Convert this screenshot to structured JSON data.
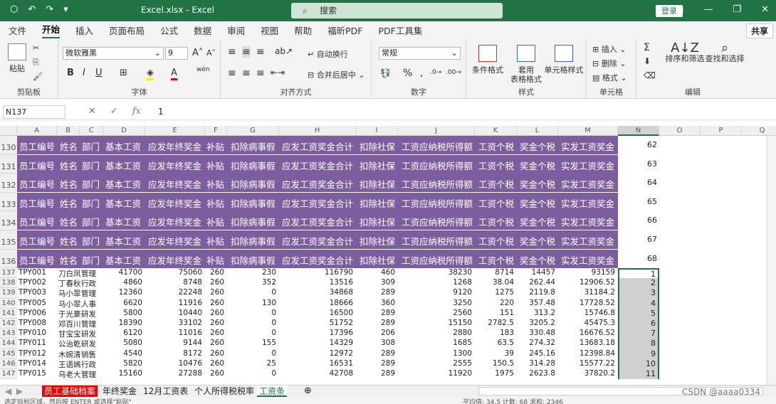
{
  "titlebar": {
    "title": "Excel.xlsx  -  Excel",
    "search": "搜索",
    "login": "登录"
  },
  "tabs": [
    "文件",
    "开始",
    "插入",
    "页面布局",
    "公式",
    "数据",
    "审阅",
    "视图",
    "帮助",
    "福昕PDF",
    "PDF工具集"
  ],
  "share": "共享",
  "ribbon": {
    "paste": "粘贴",
    "clipboard": "剪贴板",
    "font_name": "微软雅黑",
    "font_size": "9",
    "font_group": "字体",
    "wrap": "自动换行",
    "merge": "合并后居中",
    "align_group": "对齐方式",
    "number_format": "常规",
    "number_group": "数字",
    "cond": "条件格式",
    "table_fmt": "套用\n表格格式",
    "cell_style": "单元格样式",
    "style_group": "样式",
    "insert": "插入",
    "delete": "删除",
    "format": "格式",
    "cells_group": "单元格",
    "sort": "排序和筛选",
    "find": "查找和选择",
    "edit_group": "编辑"
  },
  "formula": {
    "namebox": "N137",
    "fx": "fx",
    "value": "1"
  },
  "columns": [
    "A",
    "B",
    "C",
    "D",
    "E",
    "F",
    "G",
    "H",
    "I",
    "J",
    "K",
    "L",
    "M",
    "N",
    "O",
    "P",
    "Q"
  ],
  "header_cells": [
    "员工编号",
    "姓名",
    "部门",
    "基本工资",
    "应发年终奖金",
    "补贴",
    "扣除病事假",
    "应发工资奖金合计",
    "扣除社保",
    "工资应纳税所得额",
    "工资个税",
    "奖金个税",
    "实发工资奖金"
  ],
  "header_rows": [
    {
      "row": "130",
      "n": "62"
    },
    {
      "row": "131",
      "n": "63"
    },
    {
      "row": "132",
      "n": "64"
    },
    {
      "row": "133",
      "n": "65"
    },
    {
      "row": "134",
      "n": "66"
    },
    {
      "row": "135",
      "n": "67"
    },
    {
      "row": "136",
      "n": "68"
    }
  ],
  "data_rows": [
    {
      "row": "137",
      "cells": [
        "TPY001",
        "刀白凤",
        "管理",
        "41700",
        "75060",
        "260",
        "230",
        "116790",
        "460",
        "38230",
        "8714",
        "14457",
        "93159"
      ],
      "n": "1"
    },
    {
      "row": "138",
      "cells": [
        "TPY002",
        "丁春秋",
        "行政",
        "4860",
        "8748",
        "260",
        "352",
        "13516",
        "309",
        "1268",
        "38.04",
        "262.44",
        "12906.52"
      ],
      "n": "2"
    },
    {
      "row": "139",
      "cells": [
        "TPY003",
        "马小翠",
        "管理",
        "12360",
        "22248",
        "260",
        "0",
        "34868",
        "289",
        "9120",
        "1275",
        "2119.8",
        "31184.2"
      ],
      "n": "3"
    },
    {
      "row": "140",
      "cells": [
        "TPY005",
        "马小翠",
        "人事",
        "6620",
        "11916",
        "260",
        "130",
        "18666",
        "360",
        "3250",
        "220",
        "357.48",
        "17728.52"
      ],
      "n": "4"
    },
    {
      "row": "141",
      "cells": [
        "TPY006",
        "于光豪",
        "研发",
        "5800",
        "10440",
        "260",
        "0",
        "16500",
        "289",
        "2560",
        "151",
        "313.2",
        "15746.8"
      ],
      "n": "5"
    },
    {
      "row": "142",
      "cells": [
        "TPY008",
        "邓百川",
        "管理",
        "18390",
        "33102",
        "260",
        "0",
        "51752",
        "289",
        "15150",
        "2782.5",
        "3205.2",
        "45475.3"
      ],
      "n": "6"
    },
    {
      "row": "143",
      "cells": [
        "TPY010",
        "甘宝宝",
        "研发",
        "6120",
        "11016",
        "260",
        "0",
        "17396",
        "206",
        "2880",
        "183",
        "330.48",
        "16676.52"
      ],
      "n": "7"
    },
    {
      "row": "144",
      "cells": [
        "TPY011",
        "公治乾",
        "研发",
        "5080",
        "9144",
        "260",
        "155",
        "14329",
        "308",
        "1685",
        "63.5",
        "274.32",
        "13683.18"
      ],
      "n": "8"
    },
    {
      "row": "145",
      "cells": [
        "TPY012",
        "木婉清",
        "销售",
        "4540",
        "8172",
        "260",
        "0",
        "12972",
        "289",
        "1300",
        "39",
        "245.16",
        "12398.84"
      ],
      "n": "9"
    },
    {
      "row": "146",
      "cells": [
        "TPY014",
        "王语嫣",
        "行政",
        "5820",
        "10476",
        "260",
        "25",
        "16531",
        "289",
        "2555",
        "150.5",
        "314.28",
        "15577.22"
      ],
      "n": "10"
    },
    {
      "row": "147",
      "cells": [
        "TPY015",
        "乌老大",
        "管理",
        "15160",
        "27288",
        "260",
        "0",
        "42708",
        "289",
        "11920",
        "1975",
        "2623.8",
        "37820.2"
      ],
      "n": "11"
    }
  ],
  "sheets": [
    "员工基础档案",
    "年终奖金",
    "12月工资表",
    "个人所得税税率",
    "工资条"
  ],
  "status": "选定目标区域，然后按 ENTER 或选择\"粘贴\"",
  "status_right": "平均值: 34.5    计数: 68    求和: 2346",
  "watermark": "CSDN @aaaa0334"
}
